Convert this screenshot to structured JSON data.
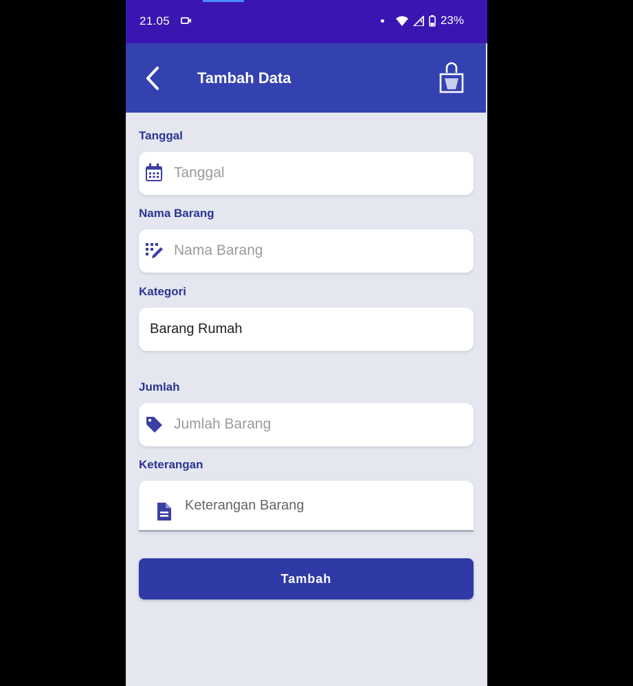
{
  "status_bar": {
    "time": "21.05",
    "battery": "23%"
  },
  "app_bar": {
    "title": "Tambah Data",
    "back_icon": "chevron-left-icon",
    "action_icon": "shopping-bag-icon"
  },
  "form": {
    "tanggal": {
      "label": "Tanggal",
      "placeholder": "Tanggal",
      "icon": "calendar-icon"
    },
    "nama_barang": {
      "label": "Nama Barang",
      "placeholder": "Nama Barang",
      "icon": "keypad-pencil-icon"
    },
    "kategori": {
      "label": "Kategori",
      "value": "Barang Rumah"
    },
    "jumlah": {
      "label": "Jumlah",
      "placeholder": "Jumlah Barang",
      "icon": "tag-icon"
    },
    "keterangan": {
      "label": "Keterangan",
      "placeholder": "Keterangan Barang",
      "icon": "document-icon"
    }
  },
  "submit": {
    "label": "Tambah"
  },
  "colors": {
    "primary": "#3442b1",
    "status_bar": "#3a15b2",
    "label": "#2a3492",
    "background": "#e4e7f0"
  }
}
